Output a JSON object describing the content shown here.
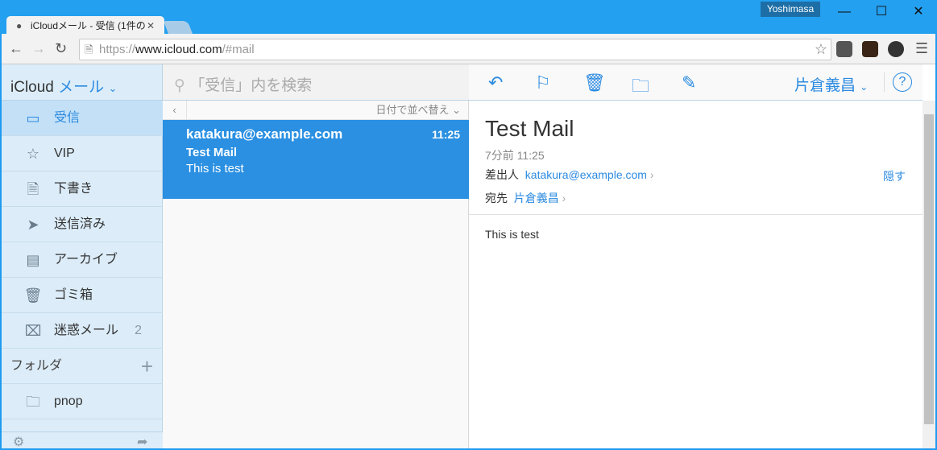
{
  "browser": {
    "tab_title": "iCloudメール - 受信 (1件の",
    "profile": "Yoshimasa",
    "url_scheme": "https://",
    "url_host": "www.icloud.com",
    "url_path": "/#mail"
  },
  "sidebar": {
    "brand": "iCloud",
    "app": "メール",
    "items": [
      {
        "label": "受信",
        "icon": "inbox-icon"
      },
      {
        "label": "VIP",
        "icon": "star-icon"
      },
      {
        "label": "下書き",
        "icon": "document-icon"
      },
      {
        "label": "送信済み",
        "icon": "send-icon"
      },
      {
        "label": "アーカイブ",
        "icon": "archive-icon"
      },
      {
        "label": "ゴミ箱",
        "icon": "trash-icon"
      },
      {
        "label": "迷惑メール",
        "icon": "junk-icon",
        "count": "2"
      }
    ],
    "folders_label": "フォルダ",
    "folders": [
      {
        "label": "pnop"
      }
    ]
  },
  "list": {
    "search_placeholder": "「受信」内を検索",
    "sort_label": "日付で並べ替え",
    "messages": [
      {
        "from": "katakura@example.com",
        "time": "11:25",
        "subject": "Test Mail",
        "preview": "This is test"
      }
    ]
  },
  "reader": {
    "user": "片倉義昌",
    "subject": "Test Mail",
    "date": "7分前 11:25",
    "from_label": "差出人",
    "from": "katakura@example.com",
    "to_label": "宛先",
    "to": "片倉義昌",
    "hide": "隠す",
    "body": "This is test"
  },
  "colors": {
    "accent": "#2b8ae0",
    "selected": "#2b90e2",
    "chrome": "#23a0f0"
  }
}
